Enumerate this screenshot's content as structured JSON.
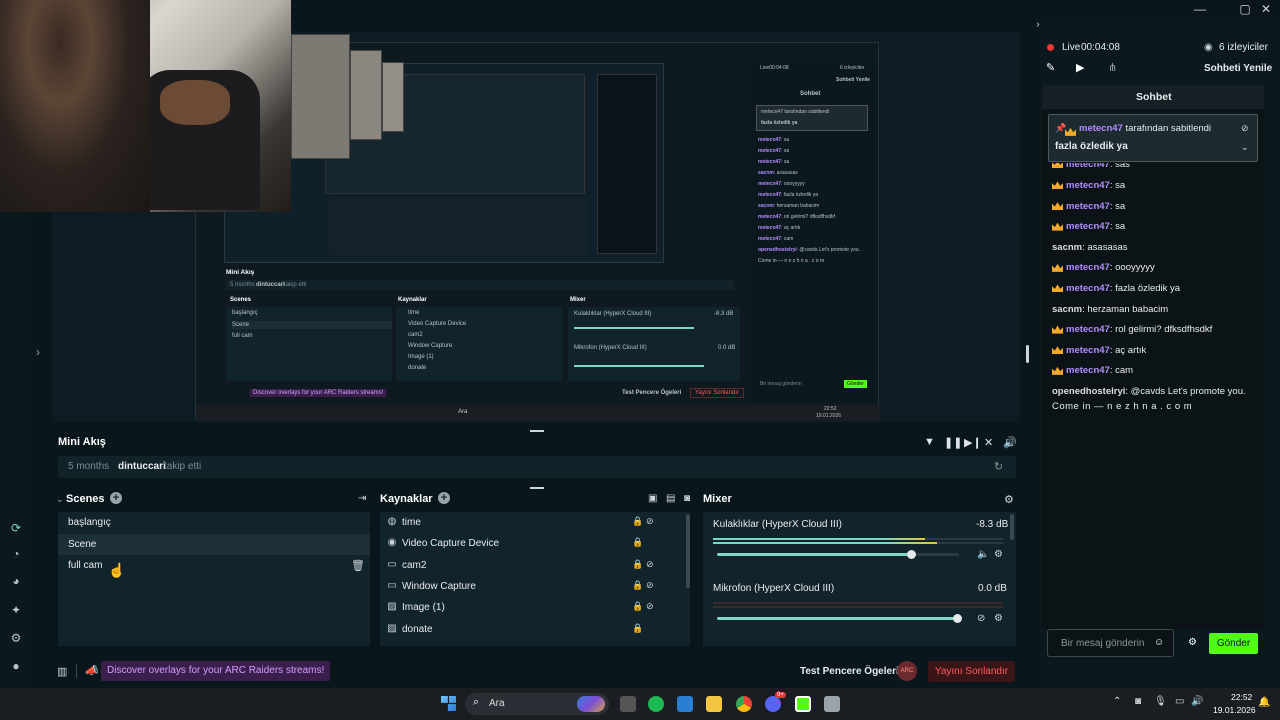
{
  "preview": {
    "nested": {
      "mini_akis": "Mini Akış",
      "activity_time": "5 months",
      "activity_user": "dintuccari",
      "activity_text": "takip etti",
      "scenes": "Scenes",
      "sources": "Kaynaklar",
      "mixer": "Mixer",
      "scene_items": [
        "başlangıç",
        "Scene",
        "full cam"
      ],
      "source_items": [
        "time",
        "Video Capture Device",
        "cam2",
        "Window Capture",
        "Image (1)",
        "donate"
      ],
      "mixer_ch1": "Kulaklıklar (HyperX Cloud III)",
      "mixer_ch1_db": "-8.3 dB",
      "mixer_ch2": "Mikrofon (HyperX Cloud III)",
      "mixer_ch2_db": "0.0 dB",
      "promo": "Discover overlays for your ARC Raiders streams!",
      "test_label": "Test Pencere Ögeleri",
      "end_stream": "Yayını Sonlandır",
      "chat_title": "Sohbet",
      "live": "Live00:04:08",
      "viewers": "6 izleyiciler",
      "refresh": "Sohbeti Yenile",
      "pinned_by": "metecn47 tarafından sabitlendi",
      "pinned_msg": "fazla özledik ya",
      "chat_input": "Bir mesaj gönderin",
      "send": "Gönder",
      "taskbar_search": "Ara",
      "time": "22:52",
      "date": "19.01.2026",
      "nested_chat": [
        {
          "user": "metecn47",
          "text": "sa"
        },
        {
          "user": "metecn47",
          "text": "sa"
        },
        {
          "user": "metecn47",
          "text": "sa"
        },
        {
          "user": "sacnm",
          "text": "asasasas"
        },
        {
          "user": "metecn47",
          "text": "oooyyyyy"
        },
        {
          "user": "metecn47",
          "text": "fazla özledik ya"
        },
        {
          "user": "sacnm",
          "text": "herzaman babacim"
        },
        {
          "user": "metecn47",
          "text": "rol gelirmi? dfksdfhsdkf"
        },
        {
          "user": "metecn47",
          "text": "aç artık"
        },
        {
          "user": "metecn47",
          "text": "cam"
        },
        {
          "user": "openedhostelryi",
          "text": "@cavds Let's promote you."
        }
      ],
      "nested_chat_cont": "Come in — n e z h n a . c o m"
    }
  },
  "main": {
    "mini_akis": "Mini Akış",
    "activity": {
      "time": "5 months",
      "user": "dintuccari",
      "text": "takip etti"
    },
    "scenes_title": "Scenes",
    "scenes": [
      "başlangıç",
      "Scene",
      "full cam"
    ],
    "sources_title": "Kaynaklar",
    "sources": [
      {
        "label": "time",
        "icon": "globe-icon"
      },
      {
        "label": "Video Capture Device",
        "icon": "webcam-icon"
      },
      {
        "label": "cam2",
        "icon": "window-icon"
      },
      {
        "label": "Window Capture",
        "icon": "window-icon"
      },
      {
        "label": "Image (1)",
        "icon": "image-icon"
      },
      {
        "label": "donate",
        "icon": "image-icon"
      }
    ],
    "mixer_title": "Mixer",
    "mixer": [
      {
        "name": "Kulaklıklar (HyperX Cloud III)",
        "db": "-8.3 dB",
        "level": 0.8
      },
      {
        "name": "Mikrofon (HyperX Cloud III)",
        "db": "0.0 dB",
        "level": 0.99
      }
    ],
    "promo": "Discover overlays for your ARC Raiders streams!",
    "test_label": "Test Pencere Ögeleri",
    "end_stream": "Yayını Sonlandır",
    "avatar": "ARC"
  },
  "chat": {
    "live_label": "Live",
    "timer": "00:04:08",
    "viewers": "6 izleyiciler",
    "refresh": "Sohbeti Yenile",
    "title": "Sohbet",
    "pinned_by_user": "metecn47",
    "pinned_by_text": "tarafından sabitlendi",
    "pinned_msg": "fazla özledik ya",
    "partial_top": {
      "user": "metecn47",
      "text": "sas"
    },
    "messages": [
      {
        "user": "metecn47",
        "text": "sa",
        "crown": true
      },
      {
        "user": "metecn47",
        "text": "sa",
        "crown": true
      },
      {
        "user": "metecn47",
        "text": "sa",
        "crown": true
      },
      {
        "user": "sacnm",
        "text": "asasasas",
        "crown": false
      },
      {
        "user": "metecn47",
        "text": "oooyyyyy",
        "crown": true
      },
      {
        "user": "metecn47",
        "text": "fazla özledik ya",
        "crown": true
      },
      {
        "user": "sacnm",
        "text": "herzaman babacim",
        "crown": false
      },
      {
        "user": "metecn47",
        "text": "rol gelirmi? dfksdfhsdkf",
        "crown": true
      },
      {
        "user": "metecn47",
        "text": "aç artık",
        "crown": true
      },
      {
        "user": "metecn47",
        "text": "cam",
        "crown": true
      },
      {
        "user": "openedhostelryi",
        "text": "@cavds Let's promote you.",
        "crown": false
      }
    ],
    "last_line": "Come in — n e z h n a . c o m",
    "input_placeholder": "Bir mesaj gönderin",
    "send": "Gönder"
  },
  "taskbar": {
    "search": "Ara",
    "time": "22:52",
    "date": "19.01.2026",
    "badge": "9+"
  },
  "colors": {
    "accent": "#7fd6c2",
    "send": "#53fc18",
    "end_stream": "#ff5c5c",
    "live": "#e53935",
    "username": "#b48cff",
    "crown": "#f0a92a",
    "promo_bg": "#3a1f4d"
  }
}
